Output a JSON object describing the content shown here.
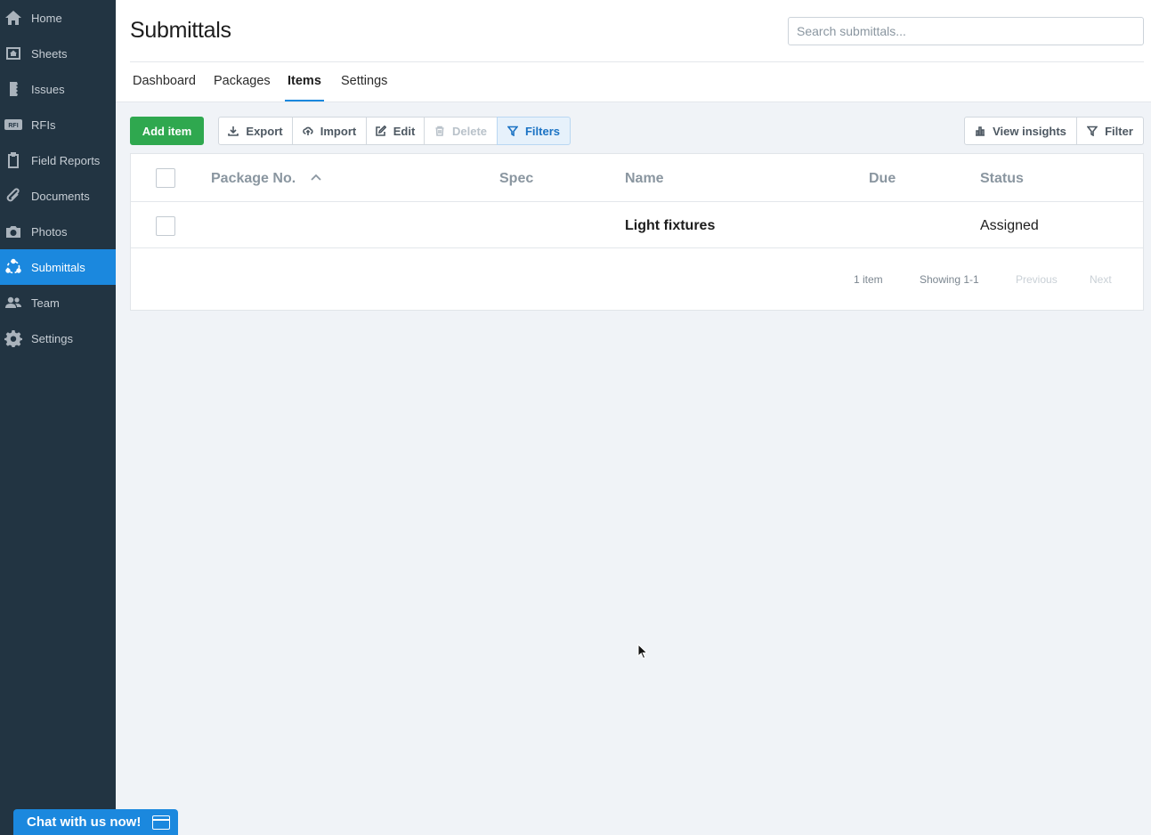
{
  "sidebar": {
    "items": [
      {
        "label": "Home",
        "icon": "home-icon"
      },
      {
        "label": "Sheets",
        "icon": "sheets-icon"
      },
      {
        "label": "Issues",
        "icon": "issues-icon"
      },
      {
        "label": "RFIs",
        "icon": "rfi-icon",
        "icon_text": "RFI"
      },
      {
        "label": "Field Reports",
        "icon": "clipboard-icon"
      },
      {
        "label": "Documents",
        "icon": "paperclip-icon"
      },
      {
        "label": "Photos",
        "icon": "camera-icon"
      },
      {
        "label": "Submittals",
        "icon": "submittals-icon",
        "active": true
      },
      {
        "label": "Team",
        "icon": "team-icon"
      },
      {
        "label": "Settings",
        "icon": "gear-icon"
      }
    ]
  },
  "header": {
    "title": "Submittals",
    "search_placeholder": "Search submittals...",
    "tabs": [
      {
        "label": "Dashboard"
      },
      {
        "label": "Packages"
      },
      {
        "label": "Items",
        "active": true
      },
      {
        "label": "Settings"
      }
    ]
  },
  "toolbar": {
    "add_item": "Add item",
    "export": "Export",
    "import": "Import",
    "edit": "Edit",
    "delete": "Delete",
    "filters": "Filters",
    "view_insights": "View insights",
    "filter": "Filter"
  },
  "table": {
    "columns": [
      "Package No.",
      "Spec",
      "Name",
      "Due",
      "Status"
    ],
    "sort_column": "Package No.",
    "rows": [
      {
        "package_no": "",
        "spec": "",
        "name": "Light fixtures",
        "due": "",
        "status": "Assigned"
      }
    ],
    "footer": {
      "count": "1 item",
      "showing": "Showing 1-1",
      "previous": "Previous",
      "next": "Next"
    }
  },
  "chat": {
    "label": "Chat with us now!"
  },
  "colors": {
    "sidebar_bg": "#223442",
    "accent": "#1b88de",
    "add_button": "#2fa84f"
  }
}
